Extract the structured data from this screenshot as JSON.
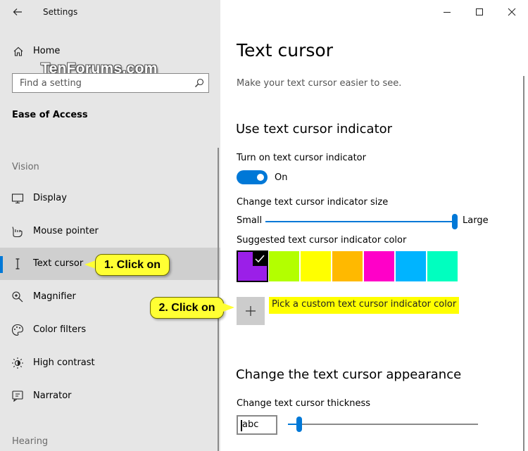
{
  "app": {
    "title": "Settings",
    "watermark": "TenForums.com"
  },
  "sidebar": {
    "home_label": "Home",
    "search_placeholder": "Find a setting",
    "section_heading": "Ease of Access",
    "group_vision": "Vision",
    "group_hearing": "Hearing",
    "items": [
      {
        "label": "Display",
        "icon": "display-icon"
      },
      {
        "label": "Mouse pointer",
        "icon": "mouse-pointer-icon"
      },
      {
        "label": "Text cursor",
        "icon": "text-cursor-icon",
        "selected": true
      },
      {
        "label": "Magnifier",
        "icon": "magnifier-icon"
      },
      {
        "label": "Color filters",
        "icon": "color-filters-icon"
      },
      {
        "label": "High contrast",
        "icon": "high-contrast-icon"
      },
      {
        "label": "Narrator",
        "icon": "narrator-icon"
      }
    ]
  },
  "main": {
    "title": "Text cursor",
    "description": "Make your text cursor easier to see.",
    "indicator": {
      "heading": "Use text cursor indicator",
      "toggle_label": "Turn on text cursor indicator",
      "toggle_state": "On",
      "size_label": "Change text cursor indicator size",
      "size_min": "Small",
      "size_max": "Large",
      "size_value_fraction": 1.0,
      "color_label": "Suggested text cursor indicator color",
      "colors": [
        "#9b1fe8",
        "#b3ff00",
        "#ffff00",
        "#ffb900",
        "#ff00c8",
        "#00b4ff",
        "#00ffbf"
      ],
      "selected_color_index": 0,
      "custom_color_label": "Pick a custom text cursor indicator color"
    },
    "appearance": {
      "heading": "Change the text cursor appearance",
      "thickness_label": "Change text cursor thickness",
      "preview_text": "abc",
      "thickness_value_fraction": 0.05
    }
  },
  "callouts": {
    "step1": "1. Click on",
    "step2": "2. Click on"
  },
  "colors": {
    "accent": "#0078d7",
    "callout": "#ffff33"
  }
}
